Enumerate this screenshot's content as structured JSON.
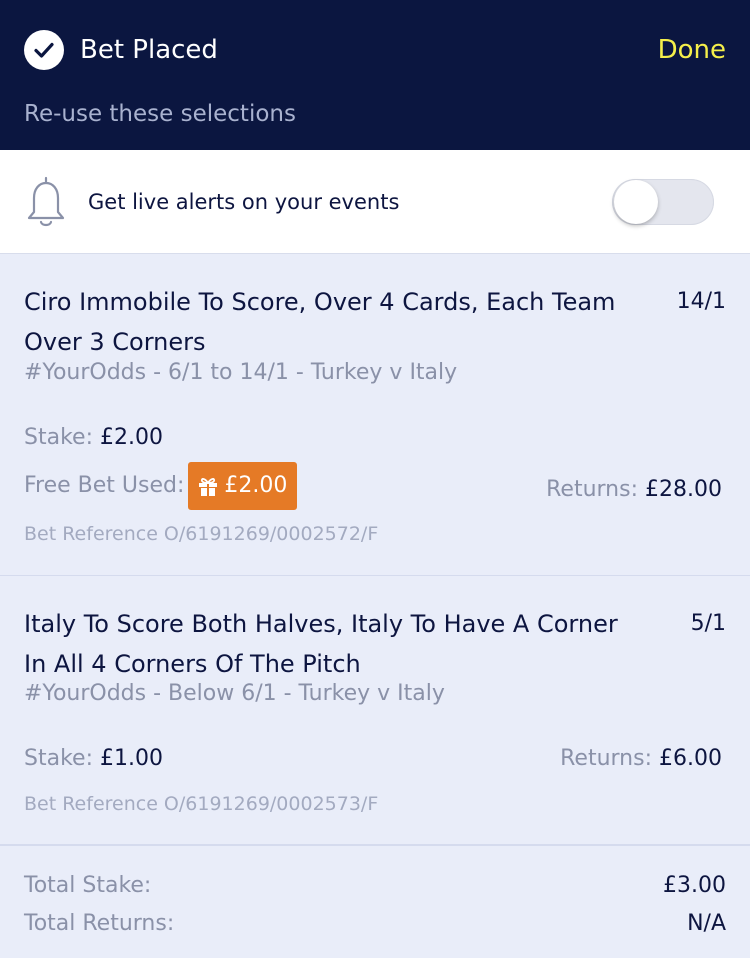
{
  "header": {
    "title": "Bet Placed",
    "done_label": "Done",
    "reuse_label": "Re-use these selections",
    "check_icon": "check-circle-icon"
  },
  "alerts": {
    "label": "Get live alerts on your events",
    "icon": "bell-icon",
    "toggle_on": false
  },
  "bets": [
    {
      "selection": "Ciro Immobile To Score, Over 4 Cards, Each Team Over 3 Corners",
      "odds": "14/1",
      "market": "#YourOdds - 6/1 to 14/1 - Turkey v Italy",
      "stake_label": "Stake:",
      "stake": "£2.00",
      "free_bet_label": "Free Bet Used:",
      "free_bet_value": "£2.00",
      "returns_label": "Returns:",
      "returns": "£28.00",
      "reference": "Bet Reference O/6191269/0002572/F"
    },
    {
      "selection": "Italy To Score Both Halves, Italy To Have A Corner In All 4 Corners Of The Pitch",
      "odds": "5/1",
      "market": "#YourOdds - Below 6/1 - Turkey v Italy",
      "stake_label": "Stake:",
      "stake": "£1.00",
      "returns_label": "Returns:",
      "returns": "£6.00",
      "reference": "Bet Reference O/6191269/0002573/F"
    }
  ],
  "totals": {
    "stake_label": "Total Stake:",
    "stake": "£3.00",
    "returns_label": "Total Returns:",
    "returns": "N/A"
  },
  "colors": {
    "header_bg": "#0b1640",
    "done": "#f5ef4a",
    "free_bet_badge": "#e57a26",
    "page_bg": "#e9edf9"
  }
}
